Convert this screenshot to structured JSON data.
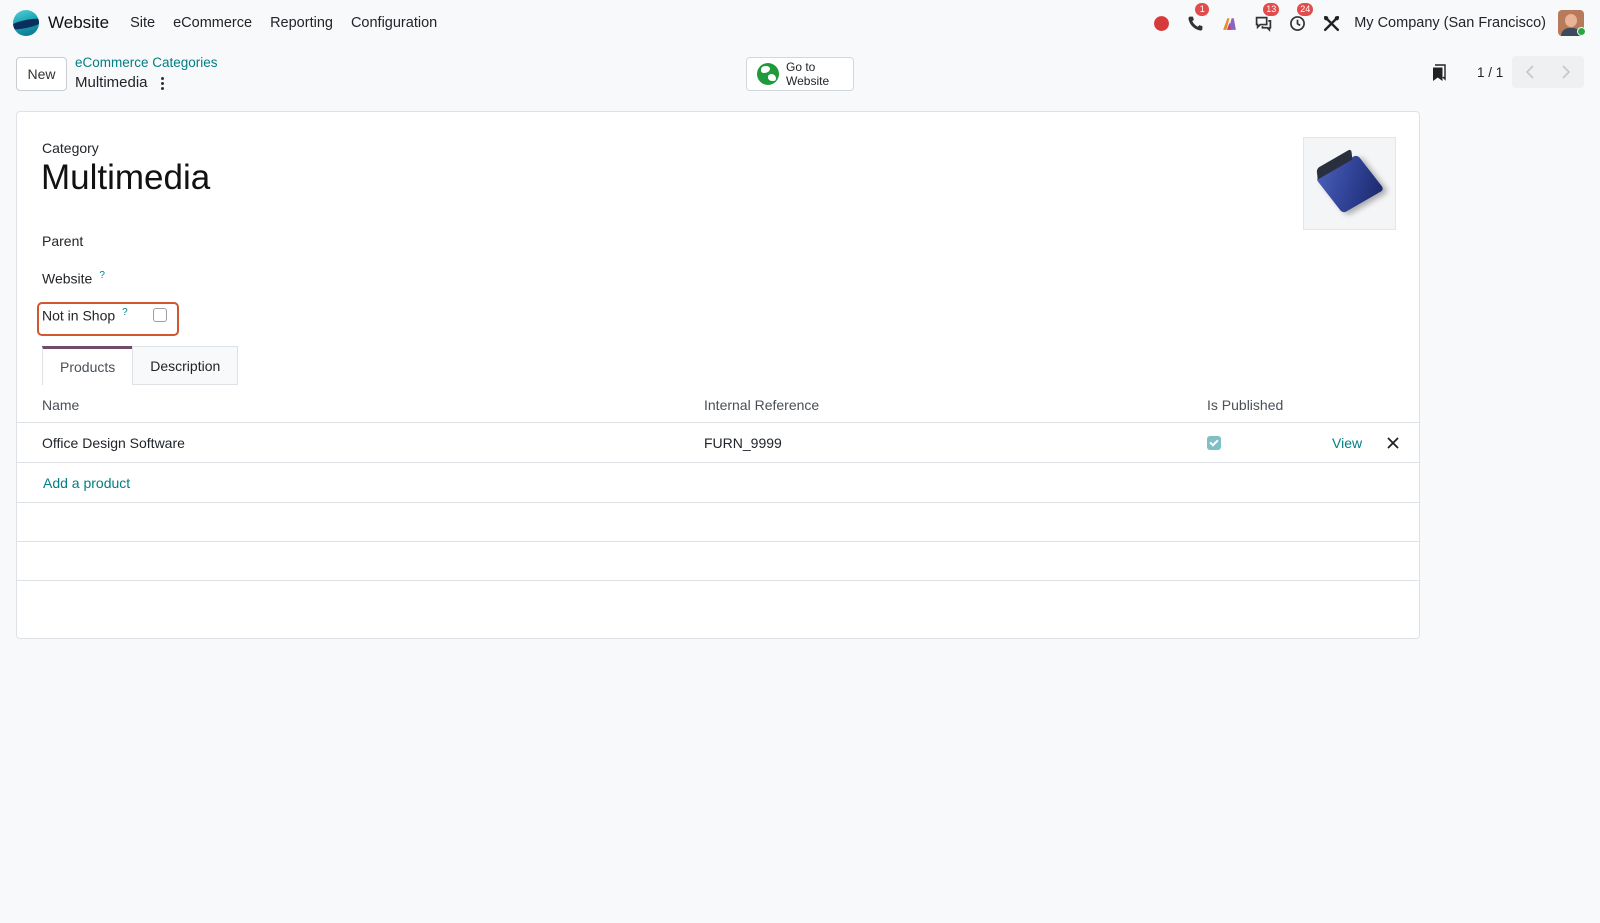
{
  "navbar": {
    "app_name": "Website",
    "menu": [
      {
        "label": "Site"
      },
      {
        "label": "eCommerce"
      },
      {
        "label": "Reporting"
      },
      {
        "label": "Configuration"
      }
    ],
    "systray": {
      "record_icon": "record-dot-icon",
      "phone_badge": "1",
      "messages_badge": "13",
      "activities_badge": "24",
      "company": "My Company (San Francisco)"
    }
  },
  "control_panel": {
    "new_label": "New",
    "breadcrumb_parent": "eCommerce Categories",
    "breadcrumb_current": "Multimedia",
    "goto_website_line1": "Go to",
    "goto_website_line2": "Website",
    "pager_value": "1 / 1"
  },
  "form": {
    "category_label": "Category",
    "title": "Multimedia",
    "parent_label": "Parent",
    "website_label": "Website",
    "not_in_shop_label": "Not in Shop",
    "help_mark": "?",
    "tabs": [
      {
        "label": "Products",
        "active": true
      },
      {
        "label": "Description",
        "active": false
      }
    ],
    "table": {
      "headers": [
        "Name",
        "Internal Reference",
        "Is Published"
      ],
      "rows": [
        {
          "name": "Office Design Software",
          "reference": "FURN_9999",
          "published": true,
          "view_label": "View"
        }
      ],
      "add_label": "Add a product"
    }
  },
  "colors": {
    "accent_teal": "#017e84",
    "highlight_border": "#d0572e",
    "tab_active": "#714b67",
    "badge_red": "#e14c4c"
  }
}
